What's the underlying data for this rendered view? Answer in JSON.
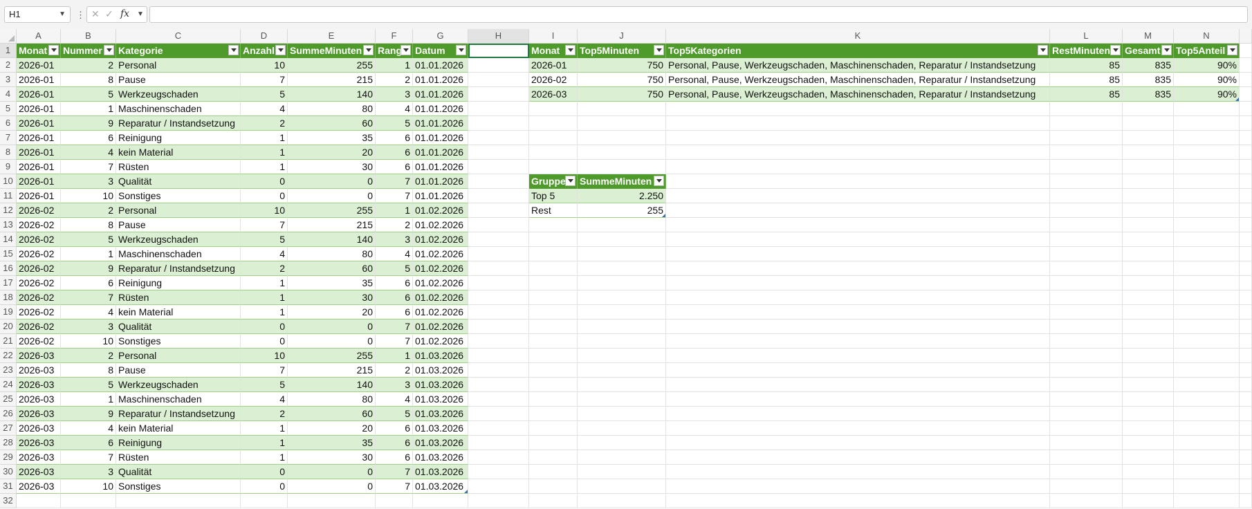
{
  "formula_bar": {
    "name_box": "H1",
    "cancel_icon": "✕",
    "enter_icon": "✓",
    "fx_label": "fx",
    "formula": ""
  },
  "columns": [
    "A",
    "B",
    "C",
    "D",
    "E",
    "F",
    "G",
    "H",
    "I",
    "J",
    "K",
    "L",
    "M",
    "N"
  ],
  "rows": [
    "1",
    "2",
    "3",
    "4",
    "5",
    "6",
    "7",
    "8",
    "9",
    "10",
    "11",
    "12",
    "13",
    "14",
    "15",
    "16",
    "17",
    "18",
    "19",
    "20",
    "21",
    "22",
    "23",
    "24",
    "25",
    "26",
    "27",
    "28",
    "29",
    "30",
    "31",
    "32"
  ],
  "table1": {
    "headers": [
      "Monat",
      "Nummer",
      "Kategorie",
      "Anzahl",
      "SummeMinuten",
      "Rang",
      "Datum"
    ],
    "rows": [
      [
        "2026-01",
        "2",
        "Personal",
        "10",
        "255",
        "1",
        "01.01.2026"
      ],
      [
        "2026-01",
        "8",
        "Pause",
        "7",
        "215",
        "2",
        "01.01.2026"
      ],
      [
        "2026-01",
        "5",
        "Werkzeugschaden",
        "5",
        "140",
        "3",
        "01.01.2026"
      ],
      [
        "2026-01",
        "1",
        "Maschinenschaden",
        "4",
        "80",
        "4",
        "01.01.2026"
      ],
      [
        "2026-01",
        "9",
        "Reparatur / Instandsetzung",
        "2",
        "60",
        "5",
        "01.01.2026"
      ],
      [
        "2026-01",
        "6",
        "Reinigung",
        "1",
        "35",
        "6",
        "01.01.2026"
      ],
      [
        "2026-01",
        "4",
        "kein Material",
        "1",
        "20",
        "6",
        "01.01.2026"
      ],
      [
        "2026-01",
        "7",
        "Rüsten",
        "1",
        "30",
        "6",
        "01.01.2026"
      ],
      [
        "2026-01",
        "3",
        "Qualität",
        "0",
        "0",
        "7",
        "01.01.2026"
      ],
      [
        "2026-01",
        "10",
        "Sonstiges",
        "0",
        "0",
        "7",
        "01.01.2026"
      ],
      [
        "2026-02",
        "2",
        "Personal",
        "10",
        "255",
        "1",
        "01.02.2026"
      ],
      [
        "2026-02",
        "8",
        "Pause",
        "7",
        "215",
        "2",
        "01.02.2026"
      ],
      [
        "2026-02",
        "5",
        "Werkzeugschaden",
        "5",
        "140",
        "3",
        "01.02.2026"
      ],
      [
        "2026-02",
        "1",
        "Maschinenschaden",
        "4",
        "80",
        "4",
        "01.02.2026"
      ],
      [
        "2026-02",
        "9",
        "Reparatur / Instandsetzung",
        "2",
        "60",
        "5",
        "01.02.2026"
      ],
      [
        "2026-02",
        "6",
        "Reinigung",
        "1",
        "35",
        "6",
        "01.02.2026"
      ],
      [
        "2026-02",
        "7",
        "Rüsten",
        "1",
        "30",
        "6",
        "01.02.2026"
      ],
      [
        "2026-02",
        "4",
        "kein Material",
        "1",
        "20",
        "6",
        "01.02.2026"
      ],
      [
        "2026-02",
        "3",
        "Qualität",
        "0",
        "0",
        "7",
        "01.02.2026"
      ],
      [
        "2026-02",
        "10",
        "Sonstiges",
        "0",
        "0",
        "7",
        "01.02.2026"
      ],
      [
        "2026-03",
        "2",
        "Personal",
        "10",
        "255",
        "1",
        "01.03.2026"
      ],
      [
        "2026-03",
        "8",
        "Pause",
        "7",
        "215",
        "2",
        "01.03.2026"
      ],
      [
        "2026-03",
        "5",
        "Werkzeugschaden",
        "5",
        "140",
        "3",
        "01.03.2026"
      ],
      [
        "2026-03",
        "1",
        "Maschinenschaden",
        "4",
        "80",
        "4",
        "01.03.2026"
      ],
      [
        "2026-03",
        "9",
        "Reparatur / Instandsetzung",
        "2",
        "60",
        "5",
        "01.03.2026"
      ],
      [
        "2026-03",
        "4",
        "kein Material",
        "1",
        "20",
        "6",
        "01.03.2026"
      ],
      [
        "2026-03",
        "6",
        "Reinigung",
        "1",
        "35",
        "6",
        "01.03.2026"
      ],
      [
        "2026-03",
        "7",
        "Rüsten",
        "1",
        "30",
        "6",
        "01.03.2026"
      ],
      [
        "2026-03",
        "3",
        "Qualität",
        "0",
        "0",
        "7",
        "01.03.2026"
      ],
      [
        "2026-03",
        "10",
        "Sonstiges",
        "0",
        "0",
        "7",
        "01.03.2026"
      ]
    ]
  },
  "table2": {
    "headers": [
      "Monat",
      "Top5Minuten",
      "Top5Kategorien",
      "RestMinuten",
      "Gesamt",
      "Top5Anteil"
    ],
    "rows": [
      [
        "2026-01",
        "750",
        "Personal, Pause, Werkzeugschaden, Maschinenschaden, Reparatur / Instandsetzung",
        "85",
        "835",
        "90%"
      ],
      [
        "2026-02",
        "750",
        "Personal, Pause, Werkzeugschaden, Maschinenschaden, Reparatur / Instandsetzung",
        "85",
        "835",
        "90%"
      ],
      [
        "2026-03",
        "750",
        "Personal, Pause, Werkzeugschaden, Maschinenschaden, Reparatur / Instandsetzung",
        "85",
        "835",
        "90%"
      ]
    ]
  },
  "table3": {
    "headers": [
      "Gruppe",
      "SummeMinuten"
    ],
    "rows": [
      [
        "Top 5",
        "2.250"
      ],
      [
        "Rest",
        "255"
      ]
    ]
  },
  "colors": {
    "header_green": "#4e9a2a",
    "band_green": "#dbefd2",
    "selection": "#1f7a3f"
  }
}
